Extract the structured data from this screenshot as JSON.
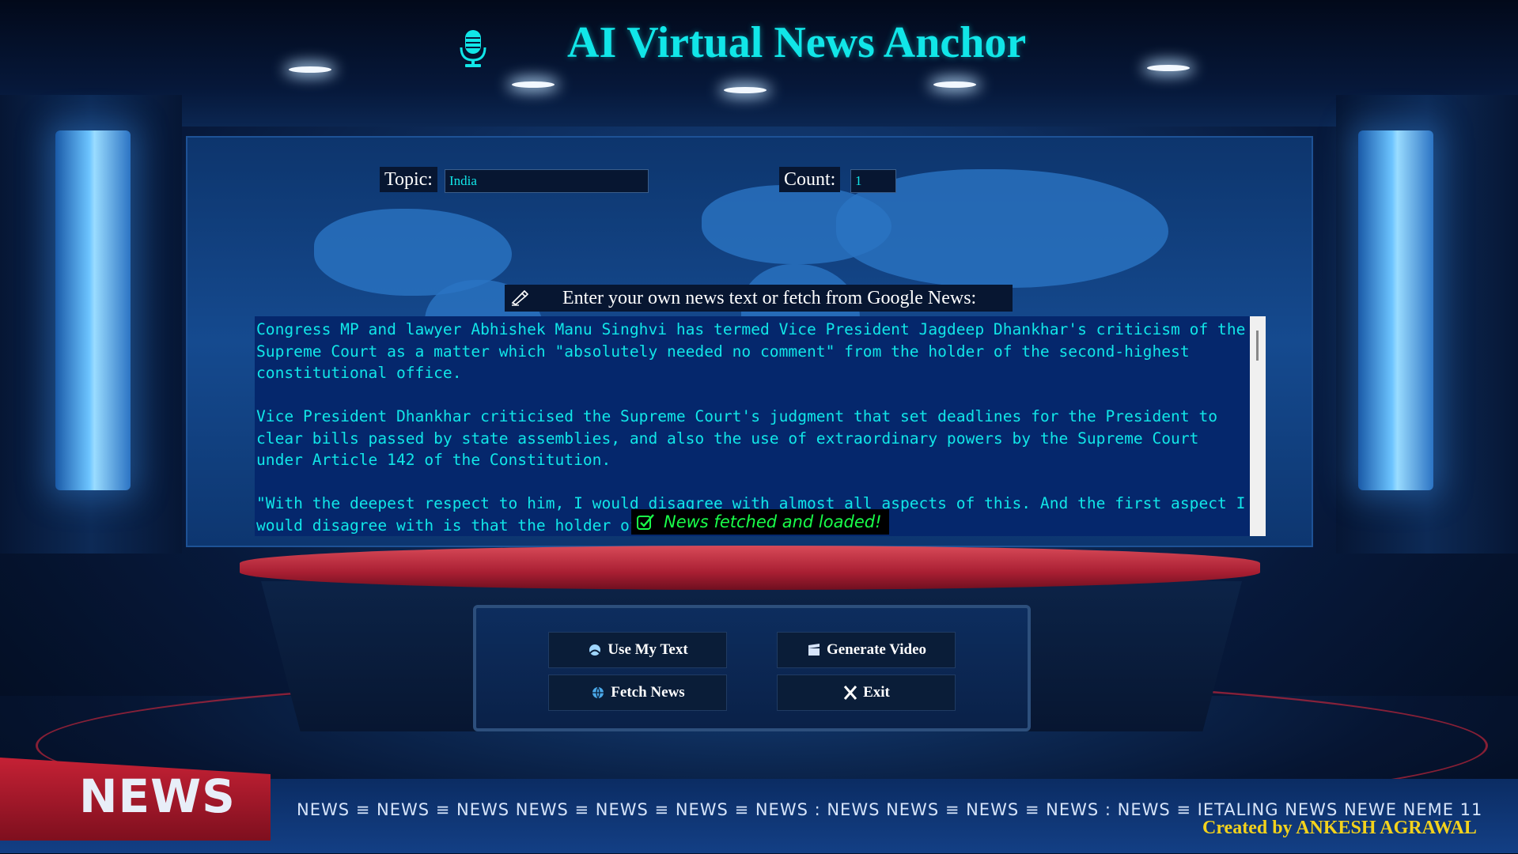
{
  "app": {
    "title": "AI Virtual News Anchor",
    "title_color": "#11e6e8"
  },
  "inputs": {
    "topic_label": "Topic:",
    "topic_value": "India",
    "count_label": "Count:",
    "count_value": "1"
  },
  "prompt": {
    "label": "Enter your own news text or fetch from Google News:",
    "icon": "writing-hand-icon"
  },
  "news_text": {
    "p1": "Congress MP and lawyer Abhishek Manu Singhvi has termed Vice President Jagdeep Dhankhar's criticism of the Supreme Court as a matter which \"absolutely needed no comment\" from the holder of the second-highest constitutional office.",
    "p2": "Vice President Dhankhar criticised the Supreme Court's judgment that set deadlines for the President to clear bills passed by state assemblies, and also the use of extraordinary powers by the Supreme Court under Article 142 of the Constitution.",
    "p3": "\"With the deepest respect to him, I would disagree with almost all aspects of this. And the first aspect I would disagree with is that the holder of a very, very high office,"
  },
  "toast": {
    "text": "News fetched and loaded!",
    "icon": "checkbox-icon",
    "color": "#19ff4a"
  },
  "buttons": {
    "use_my_text": "Use My Text",
    "generate_video": "Generate Video",
    "fetch_news": "Fetch News",
    "exit": "Exit"
  },
  "studio": {
    "news_label": "NEWS",
    "ticker": "NEWS ≡ NEWS ≡ NEWS  NEWS ≡ NEWS ≡ NEWS ≡ NEWS : NEWS  NEWS ≡ NEWS ≡ NEWS : NEWS ≡ IETALING NEWS NEWE NEME 11"
  },
  "footer": {
    "credit": "Created by ANKESH AGRAWAL",
    "credit_color": "#f3d21c"
  }
}
